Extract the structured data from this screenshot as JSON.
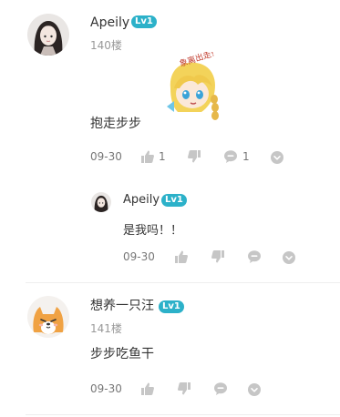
{
  "comments": [
    {
      "user": "Apeily",
      "level": "Lv1",
      "floor": "140楼",
      "sticker_text": "象离出走!",
      "text": "抱走步步",
      "date": "09-30",
      "like_count": "1",
      "reply_count": "1"
    },
    {
      "user": "想养一只汪",
      "level": "Lv1",
      "floor": "141楼",
      "text": "步步吃鱼干",
      "date": "09-30"
    }
  ],
  "reply": {
    "user": "Apeily",
    "level": "Lv1",
    "text": "是我吗！！",
    "date": "09-30"
  },
  "colors": {
    "level_badge": "#2cb1c9",
    "icon_gray": "#c6c6c6",
    "divider": "#eeeeee"
  }
}
